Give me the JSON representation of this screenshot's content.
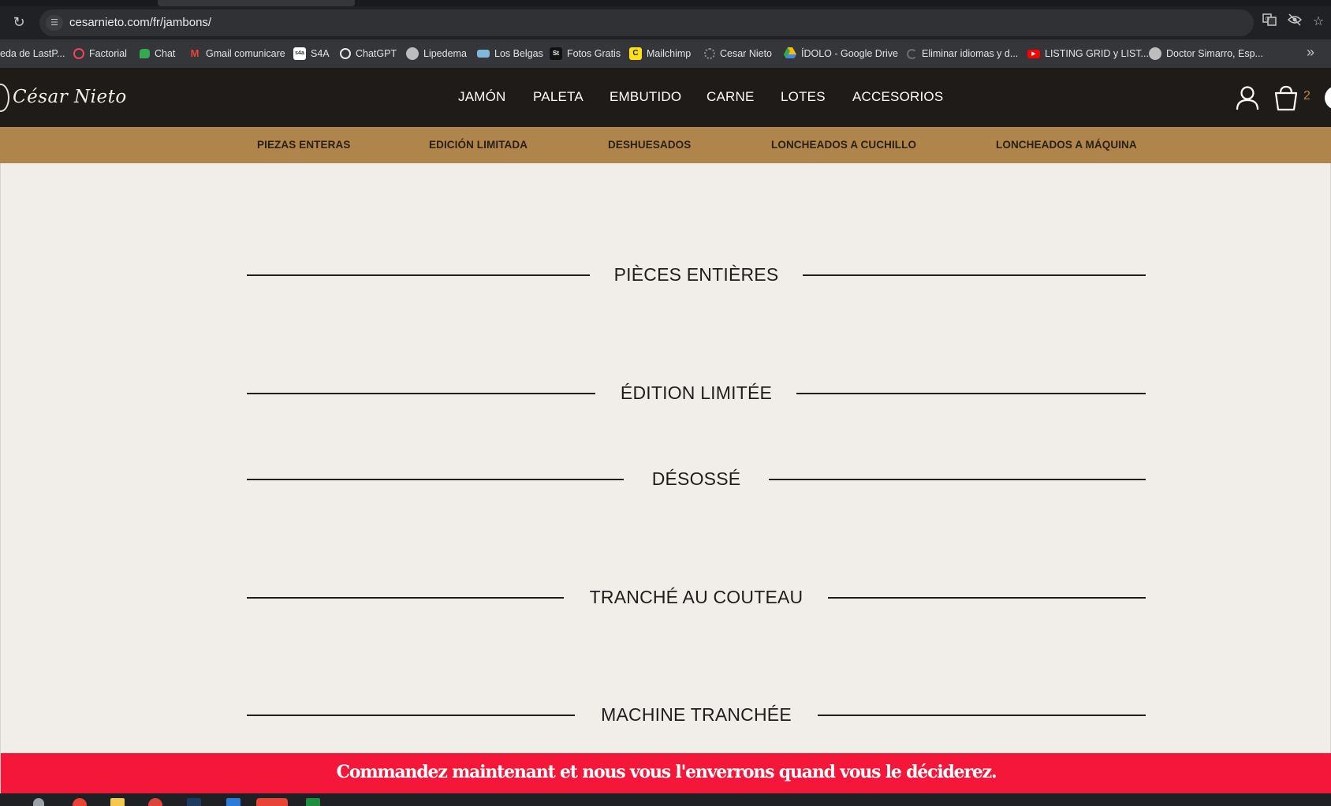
{
  "browser": {
    "url": "cesarnieto.com/fr/jambons/",
    "icons": [
      "reload-icon",
      "site-info-icon",
      "translate-icon",
      "eye-off-icon",
      "star-icon",
      "chevron-double-right-icon"
    ],
    "bookmarks": [
      {
        "label": "eda de LastP...",
        "icon": "none",
        "color": ""
      },
      {
        "label": "Factorial",
        "icon": "factorial-icon",
        "color": "#e8475e"
      },
      {
        "label": "Chat",
        "icon": "google-chat-icon",
        "color": "#34a853"
      },
      {
        "label": "Gmail comunicare",
        "icon": "gmail-icon",
        "color": "#ea4335"
      },
      {
        "label": "S4A",
        "icon": "s4a-icon",
        "color": "#ffffff"
      },
      {
        "label": "ChatGPT",
        "icon": "chatgpt-icon",
        "color": "#e8e8e8"
      },
      {
        "label": "Lipedema",
        "icon": "globe-icon",
        "color": "#bdbdbd"
      },
      {
        "label": "Los Belgas",
        "icon": "los-belgas-icon",
        "color": "#7fb8d8"
      },
      {
        "label": "Fotos Gratis",
        "icon": "stocksnap-icon",
        "color": "#111111"
      },
      {
        "label": "Mailchimp",
        "icon": "mailchimp-icon",
        "color": "#ffe01b"
      },
      {
        "label": "Cesar Nieto",
        "icon": "cesar-nieto-icon",
        "color": "#8a8a8a"
      },
      {
        "label": "ÍDOLO - Google Drive",
        "icon": "google-drive-icon",
        "color": "#fbbc04"
      },
      {
        "label": "Eliminar idiomas y d...",
        "icon": "loading-icon",
        "color": "#6b6b6b"
      },
      {
        "label": "LISTING GRID y LIST...",
        "icon": "youtube-icon",
        "color": "#ff0000"
      },
      {
        "label": "Doctor Simarro, Esp...",
        "icon": "globe-icon",
        "color": "#bdbdbd"
      }
    ]
  },
  "site": {
    "logo": "César Nieto",
    "nav": [
      "JAMÓN",
      "PALETA",
      "EMBUTIDO",
      "CARNE",
      "LOTES",
      "ACCESORIOS"
    ],
    "cart_count": "2",
    "accent_color": "#b0854b",
    "subnav": [
      "PIEZAS ENTERAS",
      "EDICIÓN LIMITADA",
      "DESHUESADOS",
      "LONCHEADOS A CUCHILLO",
      "LONCHEADOS A MÁQUINA"
    ]
  },
  "sections": [
    "PIÈCES ENTIÈRES",
    "ÉDITION LIMITÉE",
    "DÉSOSSÉ",
    "TRANCHÉ AU COUTEAU",
    "MACHINE TRANCHÉE"
  ],
  "promo": {
    "text": "Commandez maintenant et nous vous l'enverrons quand vous le déciderez.",
    "color": "#f4173a"
  }
}
